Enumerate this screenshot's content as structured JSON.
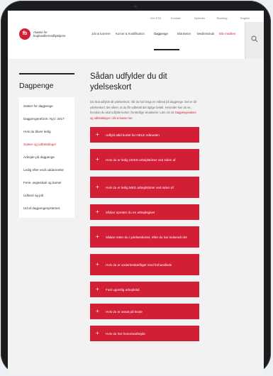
{
  "header": {
    "top_links": [
      "Om STA",
      "Kontakt",
      "Nyheder",
      "Booking",
      "English"
    ],
    "logo": {
      "mark": "fb",
      "line1": "Akasse for",
      "line2": "boghandlermedhjælpere"
    },
    "nav": [
      "Job & karriere",
      "Kurser & Kvalifikation",
      "Dagpenge",
      "Blanketter",
      "Medlemskab",
      "Bliv medlem"
    ],
    "colors": {
      "brand_red": "#d21f35"
    }
  },
  "sidebar": {
    "title": "Dagpenge",
    "items": [
      "Satser for dagpenge",
      "Dagpengereform: Nyt i 2017",
      "Hvis du bliver ledig",
      "Satser og udbetalinger",
      "Arbejde på dagpenge",
      "Ledig efter endt uddannelse",
      "Ferie, ægteskab og barsel",
      "Udland og job",
      "Ud af dagpengesystemet"
    ],
    "current_index": 3
  },
  "main": {
    "title": "Sådan udfylder du dit ydelseskort",
    "intro": "Du skal udfylde dit ydelseskort, når du har brugt en måned på dagpenge. Det er dit ydelseskort, der sikrer, at du får udbetalt det rigtige beløb. Herunder kan du se, hvordan du skal udfylde kortet i forskellige situationer. Læs om de",
    "intro_link": "Dagpengesatser og udbetalinger i din a-kasse",
    "intro_end": "her.",
    "accordions": [
      "Udfyld altid kortet for HELE måneden",
      "Hvis du er ledig UDEN arbejdstimer ved siden af",
      "Hvis du er ledig MED arbejdstimer ved siden af",
      "Sådan opretter du en arbejdsgiver",
      "Sådan retter du i ydelseskortet, efter du har indsendt det",
      "Hvis du er underbeskæftiget med forhandlede",
      "Fast ugentlig arbejdstid",
      "Hvis du er ansat på kvote",
      "Hvis du har honorararbejde"
    ]
  }
}
